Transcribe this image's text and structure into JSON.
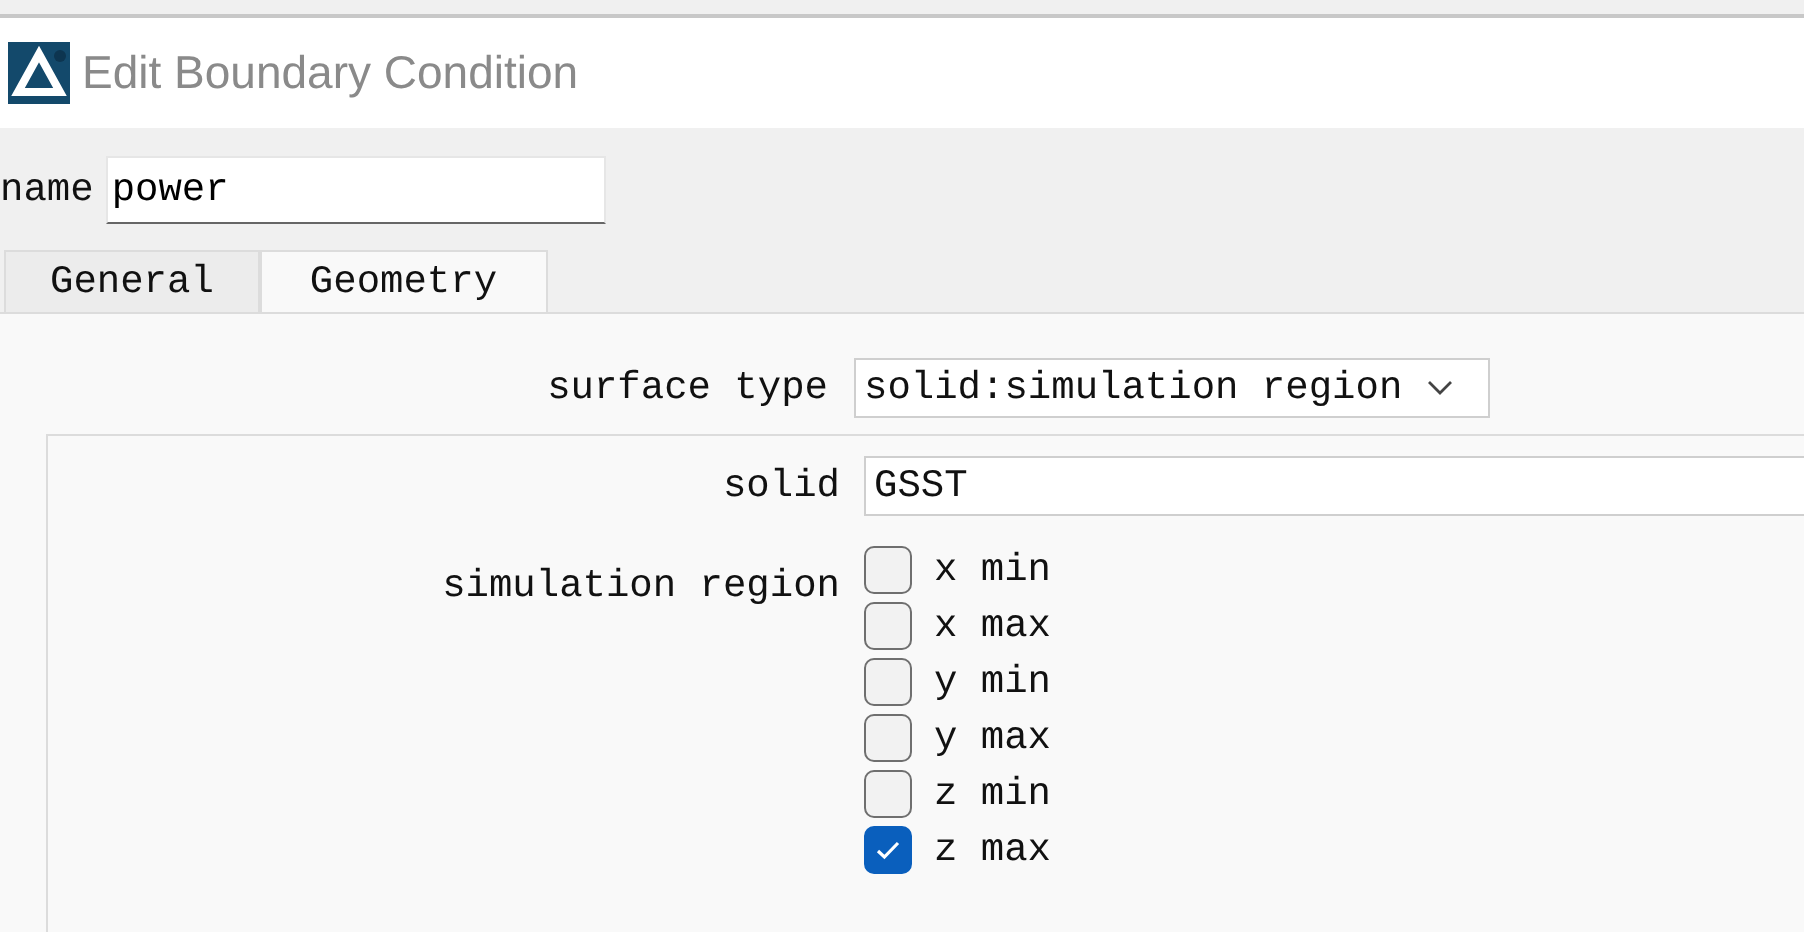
{
  "window": {
    "title": "Edit Boundary Condition"
  },
  "name_field": {
    "label": "name",
    "value": "power"
  },
  "tabs": [
    {
      "label": "General",
      "selected": false
    },
    {
      "label": "Geometry",
      "selected": true
    }
  ],
  "surface_type": {
    "label": "surface type",
    "value": "solid:simulation region"
  },
  "solid": {
    "label": "solid",
    "value": "GSST"
  },
  "simulation_region": {
    "label": "simulation region",
    "options": [
      {
        "label": "x min",
        "checked": false
      },
      {
        "label": "x max",
        "checked": false
      },
      {
        "label": "y min",
        "checked": false
      },
      {
        "label": "y max",
        "checked": false
      },
      {
        "label": "z min",
        "checked": false
      },
      {
        "label": "z max",
        "checked": true
      }
    ]
  }
}
